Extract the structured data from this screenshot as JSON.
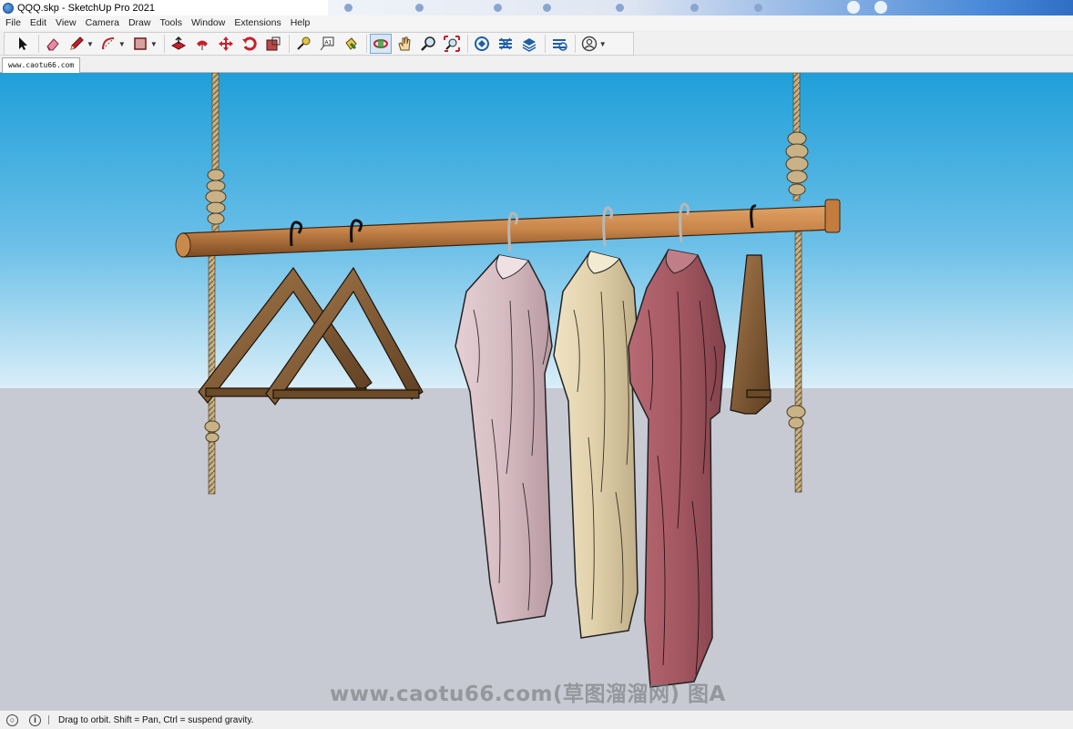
{
  "window": {
    "title": "QQQ.skp - SketchUp Pro 2021"
  },
  "menu": {
    "items": [
      "File",
      "Edit",
      "View",
      "Camera",
      "Draw",
      "Tools",
      "Window",
      "Extensions",
      "Help"
    ]
  },
  "toolbar": {
    "tools": [
      {
        "id": "select",
        "icon": "arrow-cursor-icon"
      },
      {
        "id": "eraser",
        "icon": "eraser-icon"
      },
      {
        "id": "line",
        "icon": "pencil-icon",
        "dropdown": true
      },
      {
        "id": "arc",
        "icon": "arc-icon",
        "dropdown": true
      },
      {
        "id": "rectangle",
        "icon": "rectangle-icon",
        "dropdown": true
      },
      {
        "id": "push-pull",
        "icon": "push-pull-icon"
      },
      {
        "id": "offset",
        "icon": "offset-icon"
      },
      {
        "id": "move",
        "icon": "move-icon"
      },
      {
        "id": "rotate",
        "icon": "rotate-icon"
      },
      {
        "id": "scale",
        "icon": "scale-icon"
      },
      {
        "id": "tape-measure",
        "icon": "tape-measure-icon"
      },
      {
        "id": "text",
        "icon": "text-icon"
      },
      {
        "id": "paint-bucket",
        "icon": "paint-bucket-icon"
      },
      {
        "id": "orbit",
        "icon": "orbit-icon",
        "active": true
      },
      {
        "id": "pan",
        "icon": "pan-hand-icon"
      },
      {
        "id": "zoom",
        "icon": "zoom-magnifier-icon"
      },
      {
        "id": "zoom-extents",
        "icon": "zoom-extents-icon"
      },
      {
        "id": "3d-warehouse",
        "icon": "warehouse-icon"
      },
      {
        "id": "extension-warehouse",
        "icon": "extension-warehouse-icon"
      },
      {
        "id": "layout",
        "icon": "layout-icon"
      },
      {
        "id": "extension-manager",
        "icon": "extension-manager-icon"
      },
      {
        "id": "account",
        "icon": "user-account-icon",
        "dropdown": true
      }
    ],
    "colors": {
      "accent": "#c8202a",
      "active_bg": "#d7e6f8"
    }
  },
  "scene_tab": {
    "label": "www.caotu66.com"
  },
  "viewport": {
    "sky_top": "#1f9fd9",
    "sky_bottom": "#d9eef8",
    "ground": "#c7cad2",
    "watermark": "www.caotu66.com(草图溜溜网) 图A"
  },
  "status": {
    "message": "Drag to orbit. Shift = Pan, Ctrl = suspend gravity."
  }
}
